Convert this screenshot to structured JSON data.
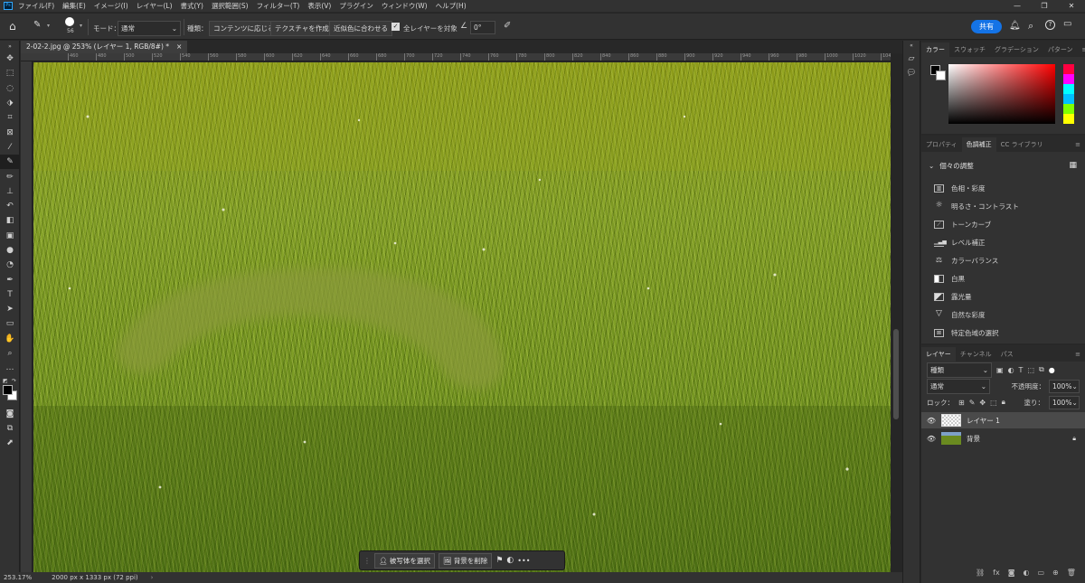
{
  "app": {
    "logo": "Ps"
  },
  "menu": [
    "ファイル(F)",
    "編集(E)",
    "イメージ(I)",
    "レイヤー(L)",
    "書式(Y)",
    "選択範囲(S)",
    "フィルター(T)",
    "表示(V)",
    "プラグイン",
    "ウィンドウ(W)",
    "ヘルプ(H)"
  ],
  "options": {
    "brush_size": "56",
    "mode_label": "モード：",
    "mode_value": "通常",
    "type_label": "種類：",
    "type_buttons": [
      "コンテンツに応じる",
      "テクスチャを作成",
      "近似色に合わせる"
    ],
    "sample_all": "全レイヤーを対象",
    "angle": "0°",
    "share": "共有"
  },
  "document": {
    "tab_title": "2-02-2.jpg @ 253% (レイヤー 1, RGB/8#) *",
    "close": "×",
    "zoom": "253.17%",
    "size_info": "2000 px x 1333 px (72 ppi)"
  },
  "ruler": [
    "460",
    "480",
    "500",
    "520",
    "540",
    "560",
    "580",
    "600",
    "620",
    "640",
    "660",
    "680",
    "700",
    "720",
    "740",
    "760",
    "780",
    "800",
    "820",
    "840",
    "860",
    "880",
    "900",
    "920",
    "940",
    "960",
    "980",
    "1000",
    "1020",
    "1040"
  ],
  "context_bar": {
    "select_subject": "被写体を選択",
    "remove_bg": "背景を削除",
    "more": "•••"
  },
  "color_panel": {
    "tabs": [
      "カラー",
      "スウォッチ",
      "グラデーション",
      "パターン"
    ],
    "hue_colors": [
      "#ff0040",
      "#ff00ff",
      "#00ffff",
      "#00c0ff",
      "#80ff00",
      "#ffff00"
    ]
  },
  "adjust_panel": {
    "tabs": [
      "プロパティ",
      "色調補正",
      "CC ライブラリ"
    ],
    "section": "個々の調整",
    "items": [
      "色相・彩度",
      "明るさ・コントラスト",
      "トーンカーブ",
      "レベル補正",
      "カラーバランス",
      "白黒",
      "露光量",
      "自然な彩度",
      "特定色域の選択"
    ]
  },
  "layers_panel": {
    "tabs": [
      "レイヤー",
      "チャンネル",
      "パス"
    ],
    "filter": "種類",
    "blend": "通常",
    "opacity_label": "不透明度：",
    "opacity": "100%",
    "lock_label": "ロック：",
    "fill_label": "塗り：",
    "fill": "100%",
    "layers": [
      {
        "name": "レイヤー 1"
      },
      {
        "name": "背景"
      }
    ]
  }
}
